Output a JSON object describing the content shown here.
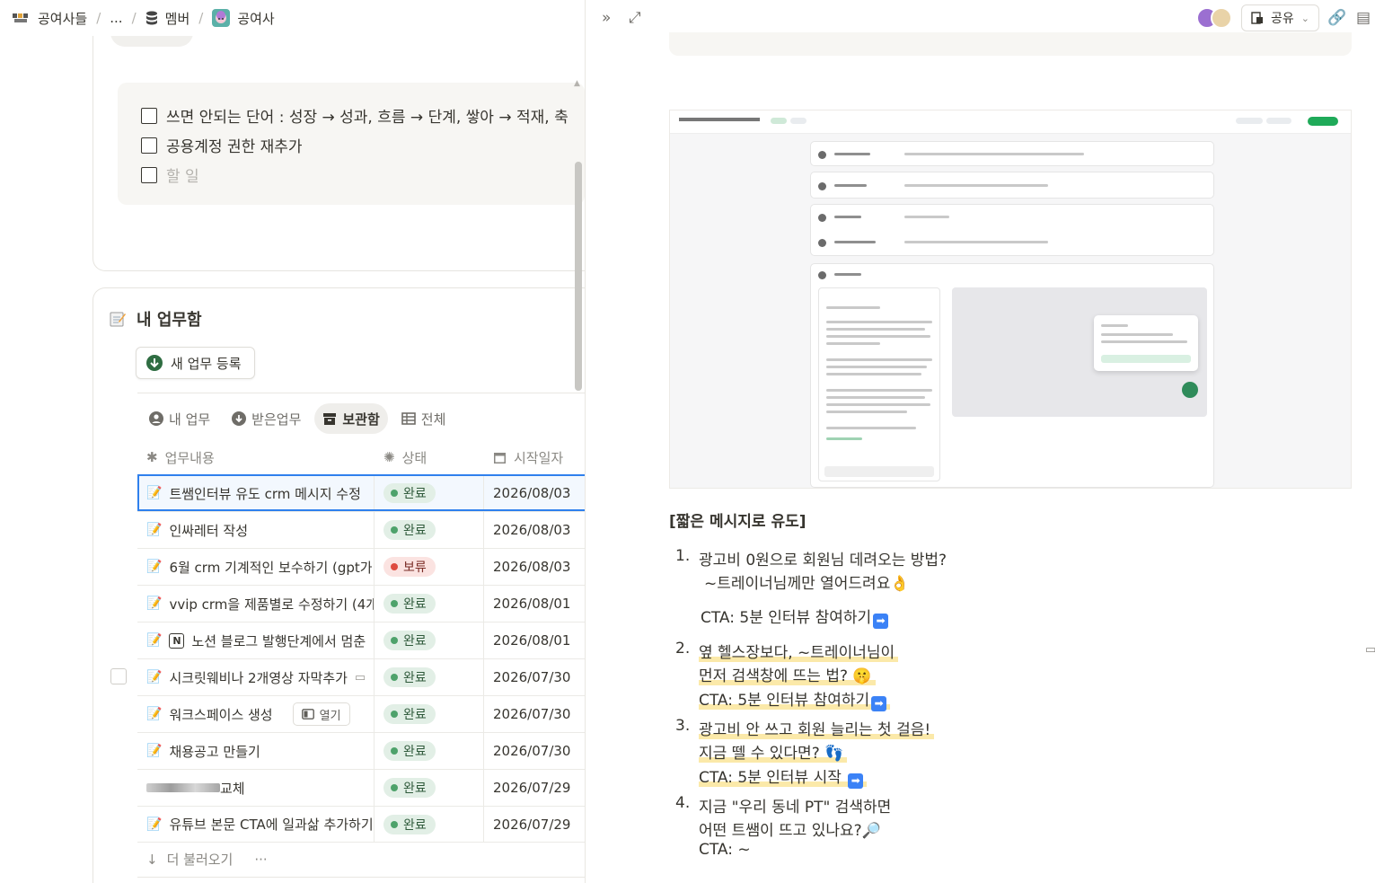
{
  "breadcrumb": {
    "workspace": "공여사들",
    "ellipsis": "...",
    "database": "멤버",
    "page": "공여사"
  },
  "todos": [
    {
      "text": "쓰면 안되는 단어 : 성장 → 성과, 흐름 → 단계, 쌓아 → 적재, 축"
    },
    {
      "text": "공용계정 권한 재추가"
    }
  ],
  "todo_placeholder": "할 일",
  "section": {
    "title": "내 업무함",
    "new_button": "새 업무 등록"
  },
  "tabs": [
    {
      "label": "내 업무",
      "icon": "user-icon"
    },
    {
      "label": "받은업무",
      "icon": "download-icon"
    },
    {
      "label": "보관함",
      "icon": "archive-icon",
      "active": true
    },
    {
      "label": "전체",
      "icon": "table-icon"
    }
  ],
  "columns": {
    "name": "업무내용",
    "status": "상태",
    "date": "시작일자"
  },
  "rows": [
    {
      "name": "트쌤인터뷰 유도 crm 메시지 수정",
      "status": "완료",
      "date": "2026/08/03"
    },
    {
      "name": "인싸레터 작성",
      "status": "완료",
      "date": "2026/08/03"
    },
    {
      "name": "6월 crm 기계적인 보수하기 (gpt가 ...",
      "status": "보류",
      "date": "2026/08/03"
    },
    {
      "name": "vvip crm을 제품별로 수정하기 (4개",
      "status": "완료",
      "date": "2026/08/01"
    },
    {
      "name": "노션 블로그 발행단계에서 멈춘",
      "status": "완료",
      "date": "2026/08/01"
    },
    {
      "name": "시크릿웨비나 2개영상 자막추가",
      "status": "완료",
      "date": "2026/07/30"
    },
    {
      "name": "워크스페이스 생성",
      "status": "완료",
      "date": "2026/07/30"
    },
    {
      "name": "채용공고 만들기",
      "status": "완료",
      "date": "2026/07/30"
    },
    {
      "name": "교체",
      "status": "완료",
      "date": "2026/07/29"
    },
    {
      "name": "유튜브 본문 CTA에 일과삶 추가하기",
      "status": "완료",
      "date": "2026/07/29"
    }
  ],
  "open_label": "열기",
  "load_more": "더 불러오기",
  "more_dots": "···",
  "share": {
    "label": "공유"
  },
  "doc": {
    "heading": "[짧은 메시지로 유도]",
    "items": [
      {
        "num": "1.",
        "lines": [
          "광고비 0원으로 회원님 데려오는 방법?",
          "~트레이너님께만 열어드려요👌",
          "CTA: 5분 인터뷰 참여하기"
        ]
      },
      {
        "num": "2.",
        "lines": [
          "옆 헬스장보다, ~트레이너님이",
          "먼저 검색창에 뜨는 법? 🤫",
          "CTA: 5분 인터뷰 참여하기"
        ]
      },
      {
        "num": "3.",
        "lines": [
          "광고비 안 쓰고 회원 늘리는 첫 걸음!",
          "지금 뗄 수 있다면? 👣",
          "CTA: 5분 인터뷰 시작"
        ]
      },
      {
        "num": "4.",
        "lines": [
          "지금 \"우리 동네 PT\" 검색하면",
          "어떤 트쌤이 뜨고 있나요?🔎",
          "CTA: ~"
        ]
      }
    ]
  },
  "colors": {
    "done": "#4ea26b",
    "hold": "#de4b40",
    "accent": "#2f80ed",
    "highlight": "#fbe9a9"
  }
}
